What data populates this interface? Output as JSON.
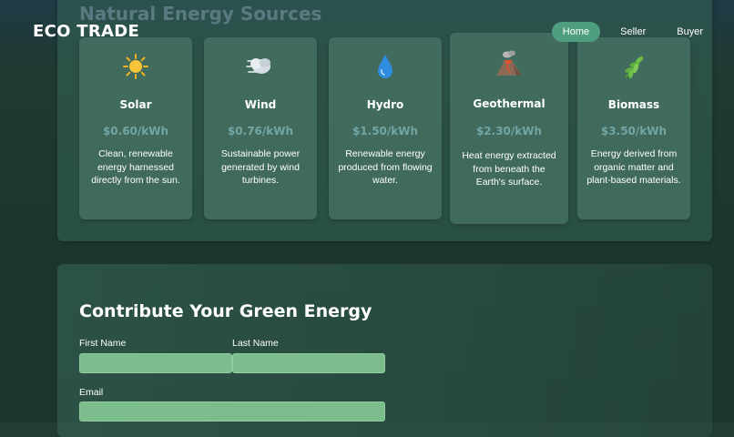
{
  "header": {
    "logo": "ECO TRADE",
    "nav": [
      {
        "label": "Home",
        "active": true
      },
      {
        "label": "Seller",
        "active": false
      },
      {
        "label": "Buyer",
        "active": false
      }
    ]
  },
  "sources": {
    "title": "Natural Energy Sources",
    "cards": [
      {
        "icon": "sun-icon",
        "name": "Solar",
        "price": "$0.60/kWh",
        "description": "Clean, renewable energy harnessed directly from the sun."
      },
      {
        "icon": "wind-icon",
        "name": "Wind",
        "price": "$0.76/kWh",
        "description": "Sustainable power generated by wind turbines."
      },
      {
        "icon": "water-drop-icon",
        "name": "Hydro",
        "price": "$1.50/kWh",
        "description": "Renewable energy produced from flowing water."
      },
      {
        "icon": "volcano-icon",
        "name": "Geothermal",
        "price": "$2.30/kWh",
        "description": "Heat energy extracted from beneath the Earth's surface."
      },
      {
        "icon": "leaf-icon",
        "name": "Biomass",
        "price": "$3.50/kWh",
        "description": "Energy derived from organic matter and plant-based materials."
      }
    ]
  },
  "contribute": {
    "title": "Contribute Your Green Energy",
    "first_name_label": "First Name",
    "first_name_value": "",
    "last_name_label": "Last Name",
    "last_name_value": "",
    "email_label": "Email",
    "email_value": ""
  },
  "colors": {
    "nav_active": "#4f9e80",
    "price": "#72a6a4",
    "input": "#7bbd8d"
  }
}
